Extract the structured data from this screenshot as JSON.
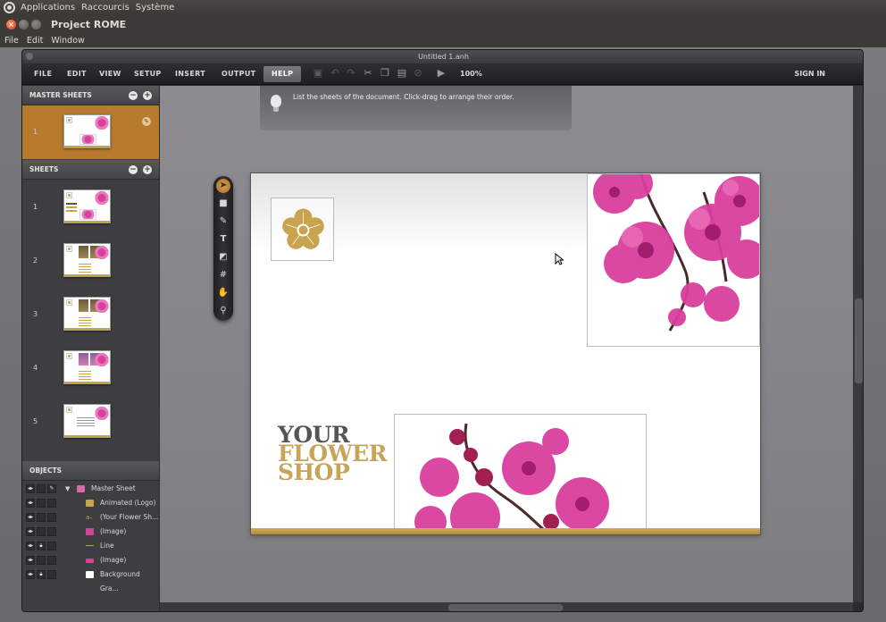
{
  "os_panel": {
    "items": [
      "Applications",
      "Raccourcis",
      "Système"
    ]
  },
  "window": {
    "title": "Project ROME",
    "menu": [
      "File",
      "Edit",
      "Window"
    ]
  },
  "app": {
    "doc_title": "Untitled 1.anh",
    "toolbar": {
      "menus": [
        "FILE",
        "EDIT",
        "VIEW",
        "SETUP",
        "INSERT",
        "OUTPUT",
        "HELP"
      ],
      "active_menu": "HELP",
      "zoom": "100%",
      "sign_in": "SIGN IN",
      "icons": [
        "save-icon",
        "undo-icon",
        "redo-icon",
        "cut-icon",
        "copy-icon",
        "paste-icon",
        "delete-icon",
        "preview-icon"
      ]
    },
    "tip": "List the sheets of the document. Click-drag to arrange their order.",
    "master_sheets": {
      "title": "MASTER SHEETS",
      "items": [
        {
          "num": "1"
        }
      ]
    },
    "sheets": {
      "title": "SHEETS",
      "items": [
        {
          "num": "1"
        },
        {
          "num": "2"
        },
        {
          "num": "3"
        },
        {
          "num": "4"
        },
        {
          "num": "5"
        }
      ]
    },
    "objects": {
      "title": "OBJECTS",
      "items": [
        {
          "label": "Master Sheet",
          "locked": false,
          "icon_color": "#d86aa8"
        },
        {
          "label": "Animated (Logo)",
          "locked": false,
          "icon_color": "#c9a44f"
        },
        {
          "label": "(Your Flower Sh...",
          "locked": false,
          "icon_color": "#c9a44f"
        },
        {
          "label": "(Image)",
          "locked": false,
          "icon_color": "#d9409a"
        },
        {
          "label": "Line",
          "locked": true,
          "icon_color": "#c9a44f"
        },
        {
          "label": "(Image)",
          "locked": false,
          "icon_color": "#d9409a"
        },
        {
          "label": "Background Gra...",
          "locked": true,
          "icon_color": "#ffffff"
        }
      ]
    },
    "tools": [
      "select-tool",
      "rectangle-tool",
      "brush-tool",
      "text-tool",
      "fill-tool",
      "grid-tool",
      "hand-tool",
      "zoom-tool"
    ],
    "page": {
      "headline": [
        "YOUR",
        "FLOWER",
        "SHOP"
      ]
    }
  },
  "colors": {
    "accent": "#b87a2c",
    "gold": "#c8a45a",
    "orchid": "#d9409a"
  }
}
